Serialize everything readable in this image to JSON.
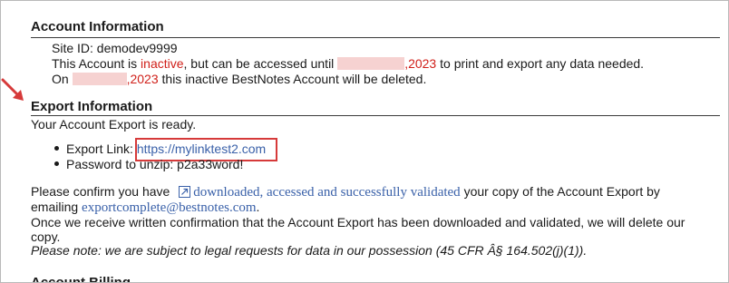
{
  "account_info": {
    "title": "Account Information",
    "site_id": "Site ID: demodev9999",
    "line2_pre": "This Account is ",
    "line2_status": "inactive",
    "line2_mid": ", but can be accessed until ",
    "line2_year": ",2023",
    "line2_post": " to print and export any data needed.",
    "line3_pre": "On ",
    "line3_year": ",2023",
    "line3_post": " this inactive BestNotes Account will be deleted."
  },
  "export_info": {
    "title": "Export Information",
    "ready": "Your Account Export is ready.",
    "link_label": "Export Link: ",
    "link_url": "https://mylinktest2.com",
    "password_label": "Password to unzip: p2a33word!",
    "confirm_pre": "Please confirm you have ",
    "confirm_link": "downloaded, accessed and successfully validated",
    "confirm_post": " your copy of the Account Export by",
    "emailing_pre": "emailing ",
    "email": "exportcomplete@bestnotes.com",
    "emailing_post": ".",
    "once_line1": "Once we receive written confirmation that the Account Export has been downloaded and validated, we will delete our",
    "once_line2": "copy.",
    "note": "Please note: we are subject to legal requests for data in our possession (45 CFR Â§ 164.502(j)(1))."
  },
  "next_section": {
    "title": "Account Billing"
  },
  "colors": {
    "accent_red": "#d0201a",
    "link_blue": "#3a61a9",
    "redaction_pink": "#f6d2d1",
    "annotation_red": "#d63a3a"
  },
  "icons": [
    "external-link-icon",
    "annotation-arrow-icon"
  ]
}
